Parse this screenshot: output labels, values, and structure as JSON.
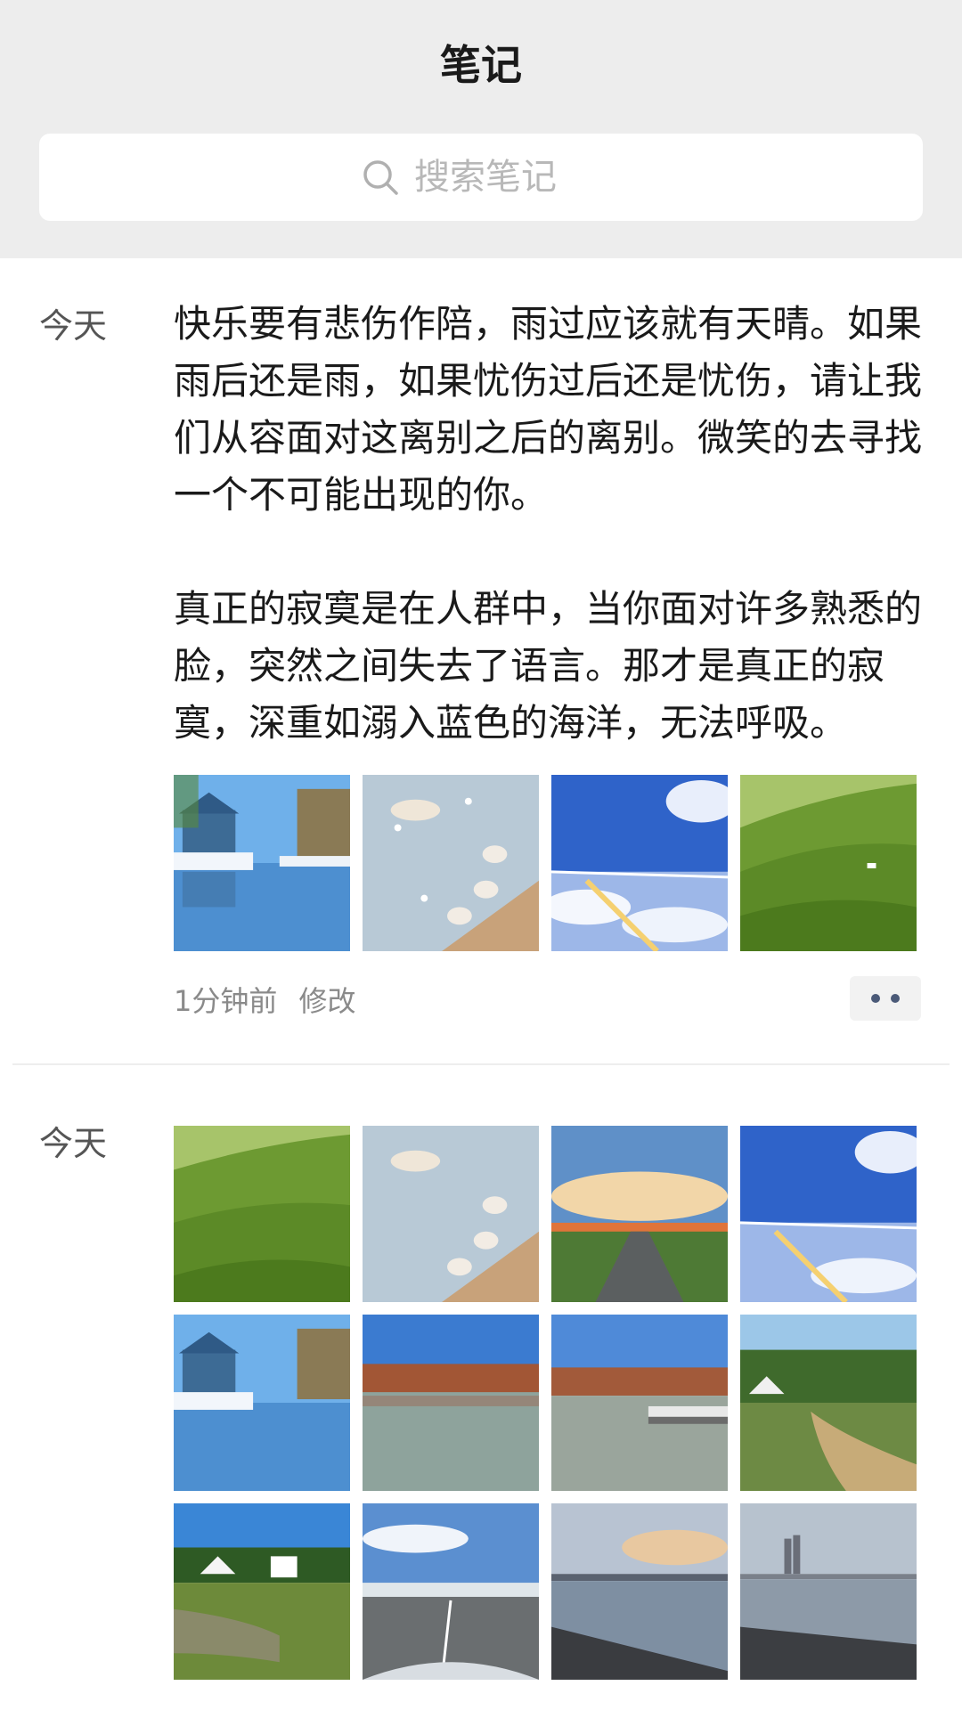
{
  "header": {
    "title": "笔记"
  },
  "search": {
    "placeholder": "搜索笔记",
    "icon": "search-icon"
  },
  "notes": [
    {
      "day": "今天",
      "paragraphs": [
        "快乐要有悲伤作陪，雨过应该就有天晴。如果雨后还是雨，如果忧伤过后还是忧伤，请让我们从容面对这离别之后的离别。微笑的去寻找一个不可能出现的你。",
        "真正的寂寞是在人群中，当你面对许多熟悉的脸，突然之间失去了语言。那才是真正的寂寞，深重如溺入蓝色的海洋，无法呼吸。"
      ],
      "images": [
        "snowy-street-reflection",
        "seagulls-on-pier",
        "sky-above-clouds",
        "green-hills"
      ],
      "time": "1分钟前",
      "edit_label": "修改",
      "more_icon": "more-dots-icon"
    },
    {
      "day": "今天",
      "images": [
        "green-hills",
        "seagulls-on-pier",
        "sunset-road",
        "sky-above-clouds",
        "snowy-street-reflection",
        "lake-with-red-trees",
        "lake-with-dock",
        "riverside-tents",
        "park-with-tents",
        "bridge-highway",
        "dusk-shoreline",
        "city-skyline-shore"
      ]
    }
  ],
  "colors": {
    "header_bg": "#ededed",
    "more_dots": "#4b5a78"
  }
}
